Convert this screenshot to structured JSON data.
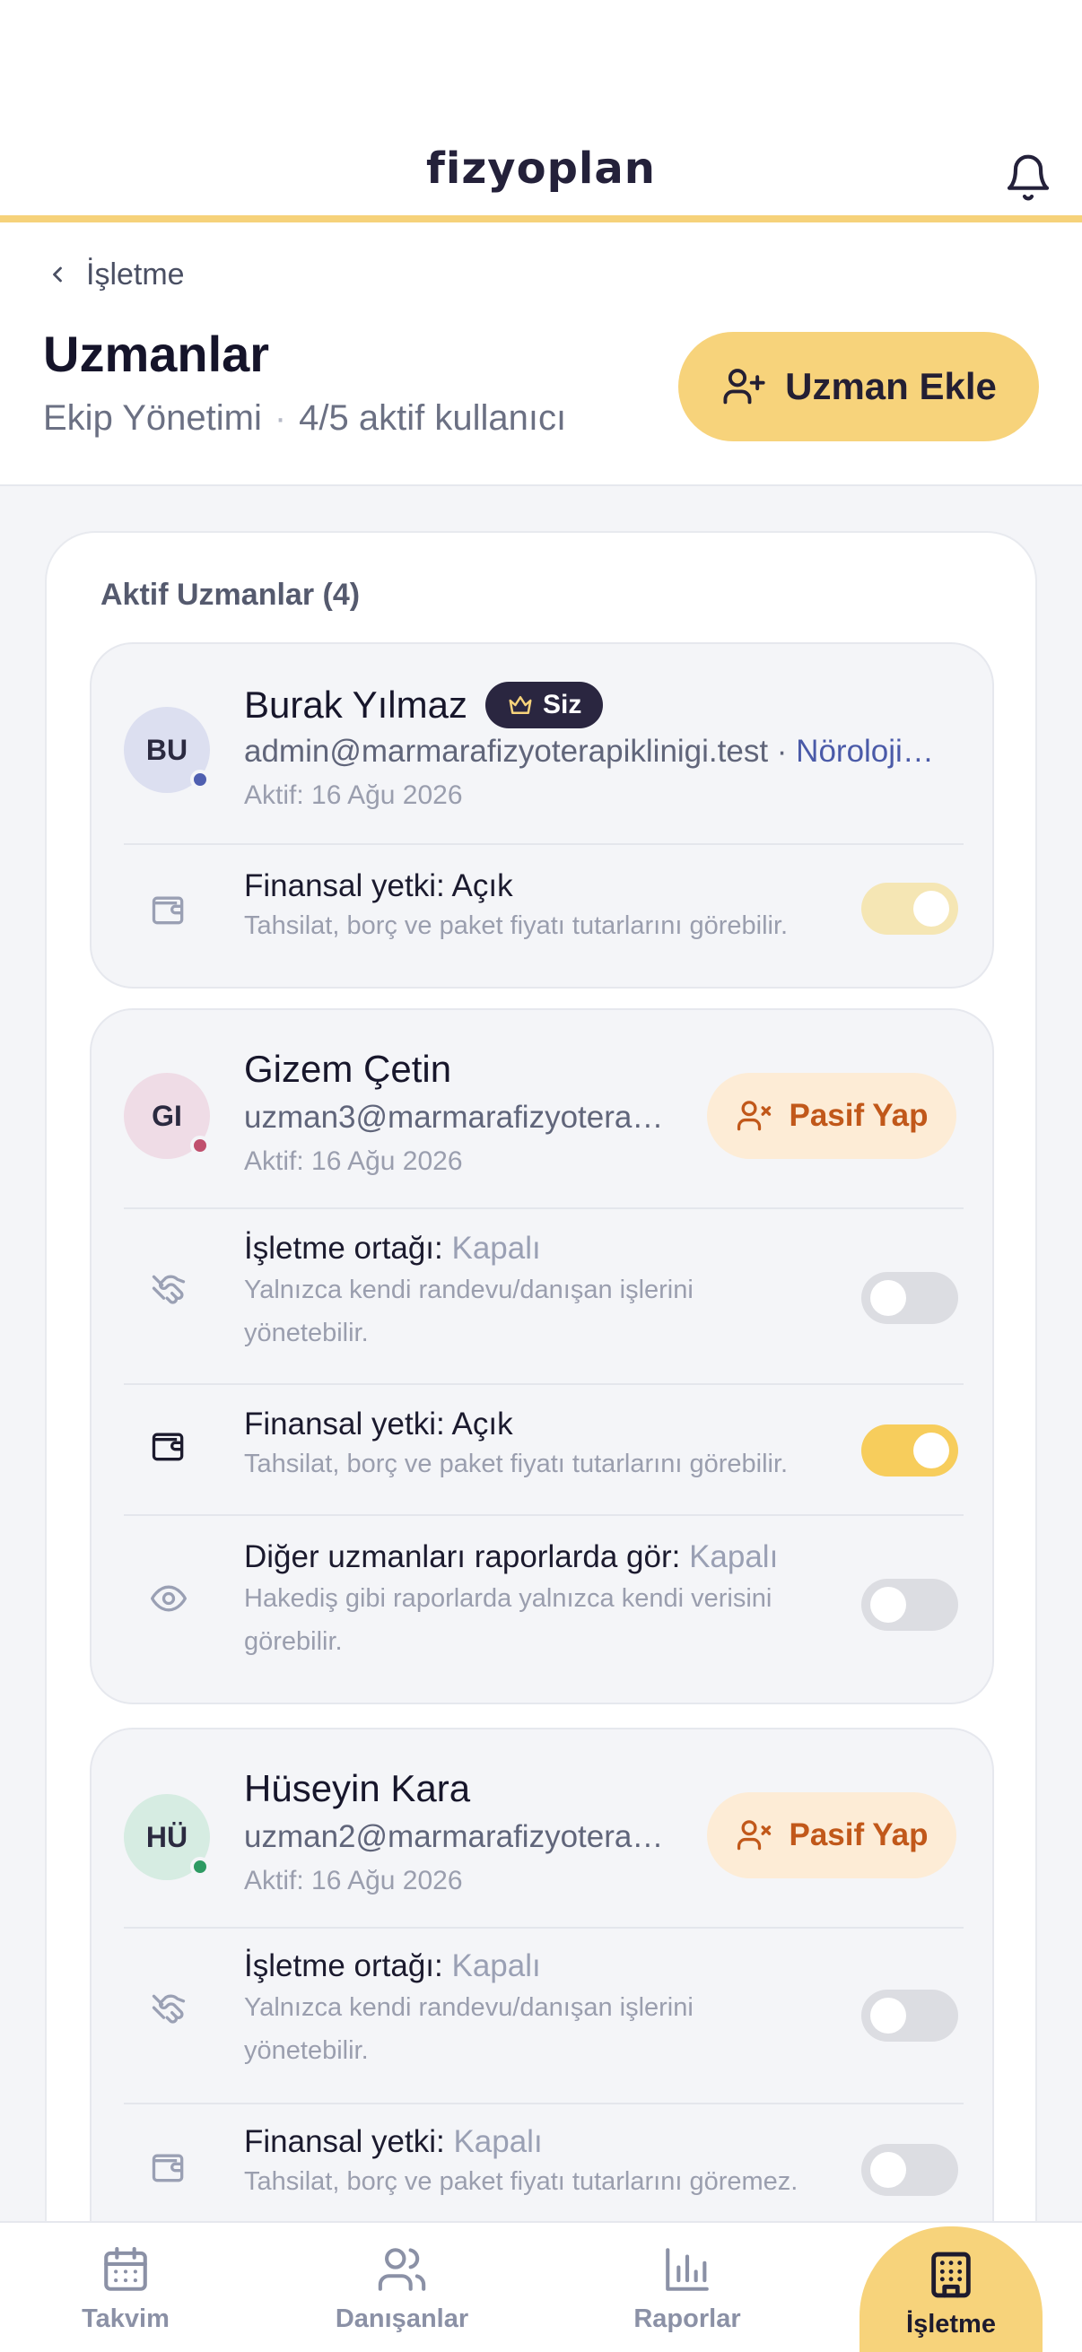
{
  "app": {
    "logo": "fizyoplan"
  },
  "header": {
    "back_label": "İşletme",
    "title": "Uzmanlar",
    "subtitle_left": "Ekip Yönetimi",
    "subtitle_right": "4/5 aktif kullanıcı",
    "add_button": "Uzman Ekle"
  },
  "list": {
    "title": "Aktif Uzmanlar (4)",
    "users": [
      {
        "initials": "BU",
        "name": "Burak Yılmaz",
        "badge": "Siz",
        "email": "admin@marmarafizyoterapiklinigi.test",
        "email_sep": " · ",
        "specialty": "Nöroloji…",
        "active": "Aktif: 16 Ağu 2026",
        "avatar_color": "#dcdff0",
        "status_color": "#4f5fb0",
        "perms": [
          {
            "title": "Finansal yetki: Açık",
            "state": "",
            "desc": "Tahsilat, borç ve paket fiyatı tutarlarını görebilir.",
            "on": true
          }
        ]
      },
      {
        "initials": "GI",
        "name": "Gizem Çetin",
        "email": "uzman3@marmarafizyotera…",
        "active": "Aktif: 16 Ağu 2026",
        "action": "Pasif Yap",
        "avatar_color": "#efdce6",
        "status_color": "#c0506e",
        "perms": [
          {
            "title": "İşletme ortağı: ",
            "state": "Kapalı",
            "desc": "Yalnızca kendi randevu/danışan işlerini yönetebilir.",
            "on": false
          },
          {
            "title": "Finansal yetki: Açık",
            "state": "",
            "desc": "Tahsilat, borç ve paket fiyatı tutarlarını görebilir.",
            "on": true
          },
          {
            "title": "Diğer uzmanları raporlarda gör: ",
            "state": "Kapalı",
            "desc": "Hakediş gibi raporlarda yalnızca kendi verisini görebilir.",
            "on": false
          }
        ]
      },
      {
        "initials": "HÜ",
        "name": "Hüseyin Kara",
        "email": "uzman2@marmarafizyotera…",
        "active": "Aktif: 16 Ağu 2026",
        "action": "Pasif Yap",
        "avatar_color": "#d6ece2",
        "status_color": "#2e9a63",
        "perms": [
          {
            "title": "İşletme ortağı: ",
            "state": "Kapalı",
            "desc": "Yalnızca kendi randevu/danışan işlerini yönetebilir.",
            "on": false
          },
          {
            "title": "Finansal yetki: ",
            "state": "Kapalı",
            "desc": "Tahsilat, borç ve paket fiyatı tutarlarını göremez.",
            "on": false
          }
        ]
      }
    ]
  },
  "nav": {
    "items": [
      "Takvim",
      "Danışanlar",
      "Raporlar",
      "İşletme"
    ],
    "active": "İşletme"
  },
  "colors": {
    "accent": "#f7d37b",
    "accent_border": "#f6d27a",
    "danger": "#c1581a"
  }
}
